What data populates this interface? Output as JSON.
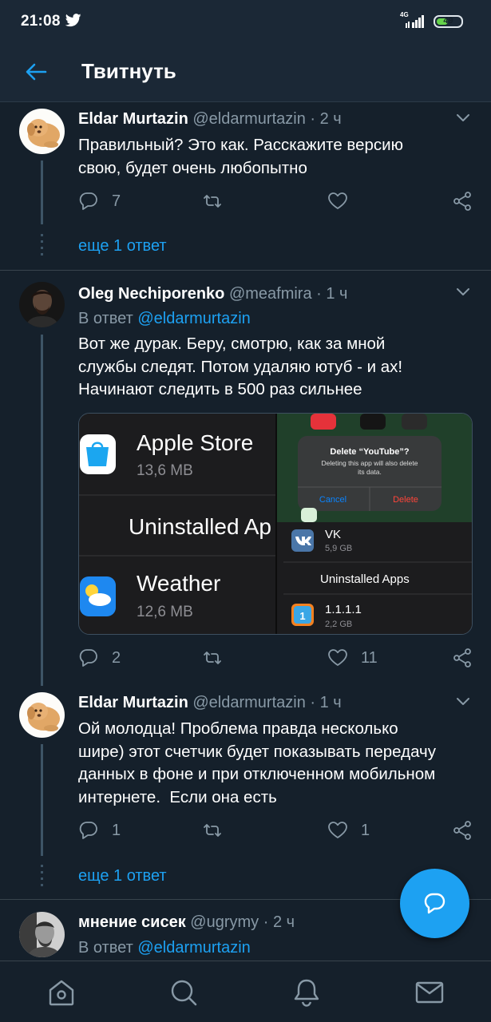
{
  "status_bar": {
    "time": "21:08",
    "network": "4G",
    "battery_level": "49",
    "battery_fraction": 0.49
  },
  "header": {
    "title": "Твитнуть"
  },
  "tweets": [
    {
      "name": "Eldar Murtazin",
      "handle": "@eldarmurtazin",
      "time": "· 2 ч",
      "text_lines": [
        "Правильный? Это как. Расскажите версию",
        "свою, будет очень любопытно"
      ],
      "reply_count": "7",
      "retweet_count": "",
      "like_count": "",
      "more_replies": "еще 1 ответ"
    },
    {
      "name": "Oleg Nechiporenko",
      "handle": "@meafmira",
      "time": "· 1 ч",
      "reply_prefix": "В ответ",
      "reply_mention": "@eldarmurtazin",
      "text_lines": [
        "Вот же дурак. Беру, смотрю, как за мной",
        "службы следят. Потом удаляю ютуб - и ах!",
        "Начинают следить в 500 раз сильнее"
      ],
      "reply_count": "2",
      "retweet_count": "",
      "like_count": "11",
      "media": {
        "left_panel": {
          "app1_name": "Apple Store",
          "app1_size": "13,6 MB",
          "section_label": "Uninstalled Ap",
          "app2_name": "Weather",
          "app2_size": "12,6 MB"
        },
        "right_panel": {
          "dialog_title": "Delete “YouTube”?",
          "dialog_body_1": "Deleting this app will also delete",
          "dialog_body_2": "its data.",
          "cancel": "Cancel",
          "delete": "Delete",
          "app1_name": "VK",
          "app1_size": "5,9 GB",
          "section_label": "Uninstalled Apps",
          "app2_name": "1.1.1.1",
          "app2_size": "2,2 GB"
        }
      }
    },
    {
      "name": "Eldar Murtazin",
      "handle": "@eldarmurtazin",
      "time": "· 1 ч",
      "text_lines": [
        "Ой молодца! Проблема правда несколько",
        "шире) этот счетчик будет показывать передачу",
        "данных в фоне и при отключенном мобильном",
        "интернете.  Если она есть"
      ],
      "reply_count": "1",
      "retweet_count": "",
      "like_count": "1",
      "more_replies": "еще 1 ответ"
    },
    {
      "name": "мнение сисек",
      "handle": "@ugrymy",
      "time": "· 2 ч",
      "reply_prefix": "В ответ",
      "reply_mention": "@eldarmurtazin"
    }
  ],
  "icons": {
    "status": [
      "twitter-icon",
      "signal-icon",
      "battery-icon"
    ],
    "header": [
      "back-arrow-icon"
    ],
    "actions": [
      "reply-icon",
      "retweet-icon",
      "like-icon",
      "share-icon",
      "chevron-down-icon"
    ],
    "fab": "compose-reply-icon",
    "nav": [
      "home-icon",
      "search-icon",
      "notifications-icon",
      "messages-icon"
    ]
  },
  "colors": {
    "background": "#15202b",
    "accent": "#1da1f2",
    "secondary_text": "#8899a6",
    "delete_red": "#ff453a",
    "battery_green": "#65d34a"
  }
}
